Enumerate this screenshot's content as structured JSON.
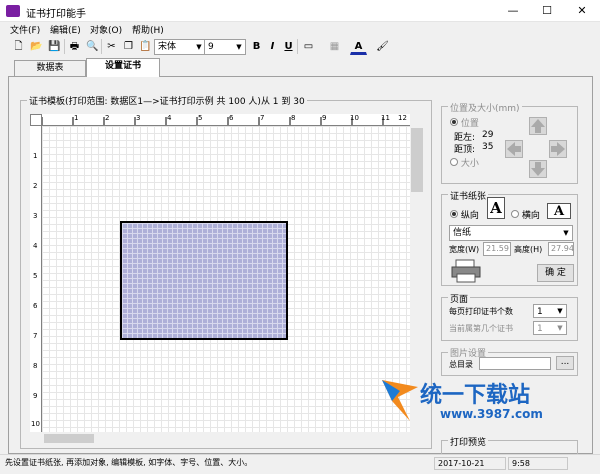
{
  "window": {
    "title": "证书打印能手",
    "controls": [
      "—",
      "☐",
      "✕"
    ]
  },
  "menu": [
    "文件(F)",
    "编辑(E)",
    "对象(O)",
    "帮助(H)"
  ],
  "toolbar": {
    "font_name": "宋体",
    "font_size": "9",
    "bold": "B",
    "italic": "I",
    "underline": "U",
    "text_color_glyph": "A"
  },
  "tabs": [
    {
      "label": "数据表"
    },
    {
      "label": "设置证书"
    }
  ],
  "template_group": {
    "label": "证书模板(打印范围:  数据区1—>证书打印示例  共 100 人)从  1  到  30",
    "hruler_ticks": [
      "1",
      "2",
      "3",
      "4",
      "5",
      "6",
      "7",
      "8",
      "9",
      "10",
      "11",
      "12"
    ],
    "vruler_ticks": [
      "1",
      "2",
      "3",
      "4",
      "5",
      "6",
      "7",
      "8",
      "9",
      "10"
    ]
  },
  "position": {
    "label": "位置及大小(mm)",
    "radio_position": "位置",
    "left_label": "距左:",
    "left_value": "29",
    "top_label": "距顶:",
    "top_value": "35",
    "radio_size": "大小"
  },
  "paper": {
    "label": "证书纸张",
    "portrait": "纵向",
    "landscape": "横向",
    "glyph": "A",
    "paper_type": "信纸",
    "width_label": "宽度(W)",
    "width_value": "21.59",
    "height_label": "高度(H)",
    "height_value": "27.94",
    "ok_button": "确 定"
  },
  "page": {
    "label": "页面",
    "per_page_label": "每页打印证书个数",
    "per_page_value": "1",
    "current_label": "当前属第几个证书",
    "current_value": "1"
  },
  "image": {
    "label": "图片设置",
    "dir_label": "总目录",
    "browse": "..."
  },
  "preview": {
    "label": "打印预览"
  },
  "watermark": {
    "brand": "统一下载站",
    "url": "www.3987.com"
  },
  "status": {
    "hint": "先设置证书纸张, 再添加对象, 编辑模板, 如字体、字号、位置、大小。",
    "date": "2017-10-21",
    "time": "9:58"
  }
}
